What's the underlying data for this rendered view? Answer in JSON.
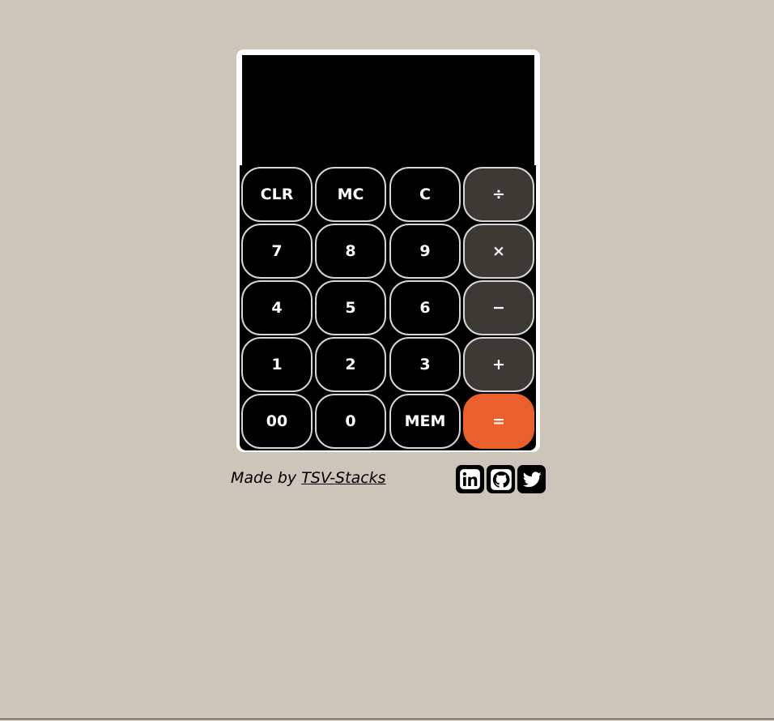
{
  "display": {
    "value": ""
  },
  "keys": {
    "clr": "CLR",
    "mc": "MC",
    "c": "C",
    "divide": "÷",
    "seven": "7",
    "eight": "8",
    "nine": "9",
    "multiply": "×",
    "four": "4",
    "five": "5",
    "six": "6",
    "minus": "−",
    "one": "1",
    "two": "2",
    "three": "3",
    "plus": "+",
    "double_zero": "00",
    "zero": "0",
    "mem": "MEM",
    "equals": "="
  },
  "footer": {
    "made_by": "Made by",
    "author": "TSV-Stacks"
  },
  "socials": {
    "linkedin_icon": "linkedin-icon",
    "github_icon": "github-icon",
    "twitter_icon": "twitter-icon"
  },
  "colors": {
    "background": "#cbc5ba",
    "operator": "#3d3a36",
    "equals": "#eb5f2c"
  }
}
